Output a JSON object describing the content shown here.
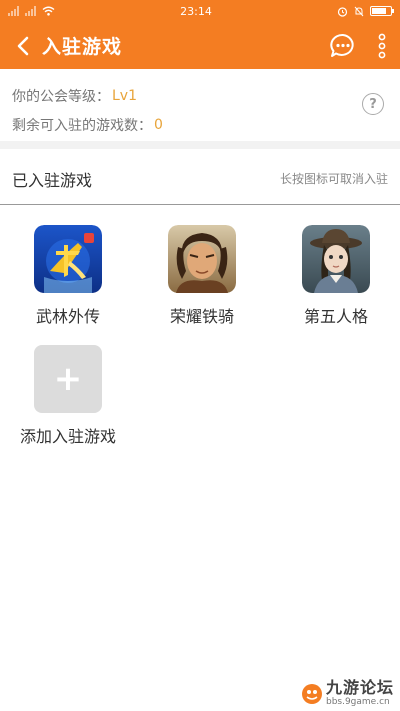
{
  "status_bar": {
    "time": "23:14",
    "battery_icon": "battery-icon",
    "alarm_icon": "alarm-icon",
    "wifi_icon": "wifi-icon"
  },
  "header": {
    "title": "入驻游戏",
    "back_icon": "chevron-left-icon",
    "message_icon": "chat-bubble-icon",
    "more_icon": "more-vertical-icon"
  },
  "info": {
    "level_label": "你的公会等级：",
    "level_value": "Lv1",
    "remaining_label": "剩余可入驻的游戏数：",
    "remaining_value": "0",
    "help_icon": "?"
  },
  "section": {
    "title": "已入驻游戏",
    "hint": "长按图标可取消入驻"
  },
  "games": [
    {
      "name": "武林外传",
      "icon": "wulin-game-icon"
    },
    {
      "name": "荣耀铁骑",
      "icon": "rongyao-game-icon"
    },
    {
      "name": "第五人格",
      "icon": "identity-v-game-icon"
    }
  ],
  "add_game": {
    "label": "添加入驻游戏",
    "symbol": "+"
  },
  "watermark": {
    "name": "九游论坛",
    "url": "bbs.9game.cn"
  },
  "colors": {
    "accent": "#f47d22",
    "value": "#e8a43a"
  }
}
